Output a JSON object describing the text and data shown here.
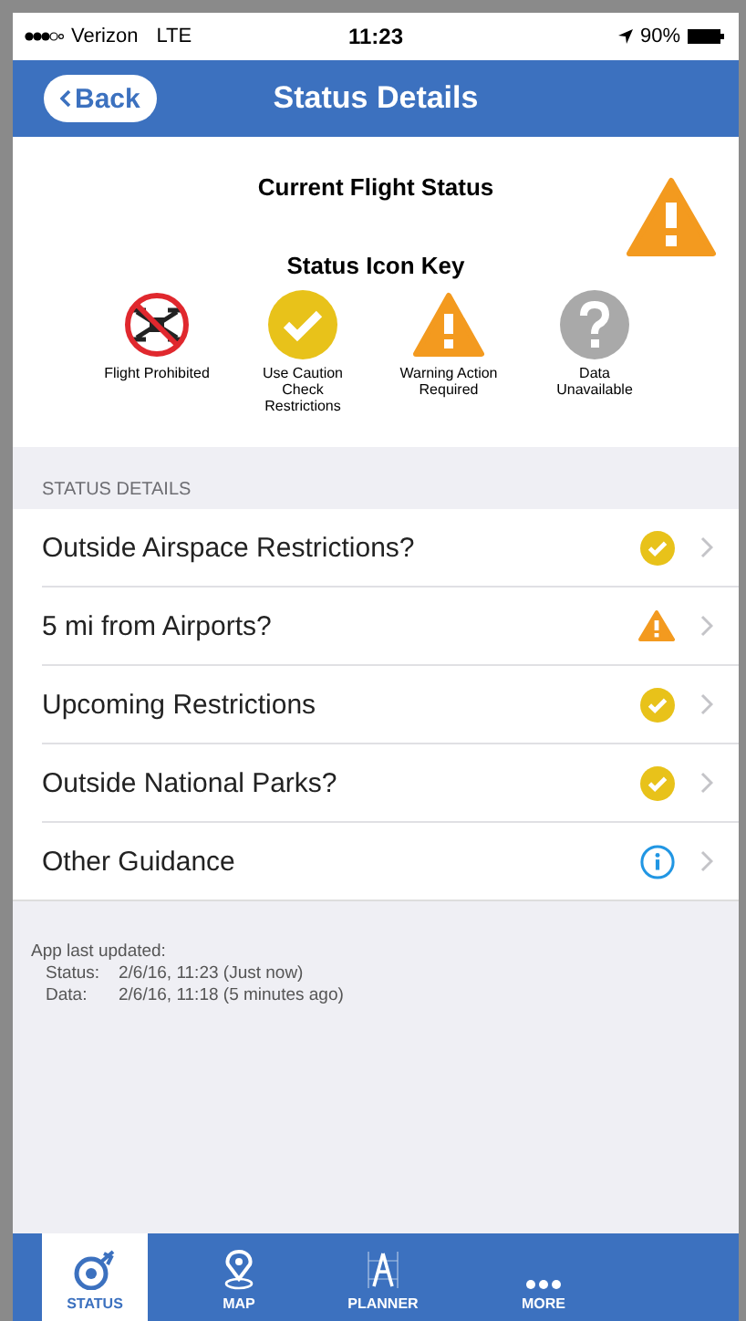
{
  "status_bar": {
    "carrier": "Verizon",
    "network": "LTE",
    "time": "11:23",
    "battery": "90%"
  },
  "nav": {
    "back": "Back",
    "title": "Status Details"
  },
  "current": {
    "title": "Current Flight Status",
    "kind": "warning"
  },
  "key": {
    "title": "Status Icon Key",
    "items": [
      {
        "kind": "prohibited",
        "label": "Flight Prohibited"
      },
      {
        "kind": "caution",
        "label": "Use Caution Check Restrictions"
      },
      {
        "kind": "warning",
        "label": "Warning Action Required"
      },
      {
        "kind": "unknown",
        "label": "Data Unavailable"
      }
    ]
  },
  "section": "STATUS DETAILS",
  "rows": [
    {
      "label": "Outside Airspace Restrictions?",
      "kind": "caution"
    },
    {
      "label": "5 mi from Airports?",
      "kind": "warning"
    },
    {
      "label": "Upcoming Restrictions",
      "kind": "caution"
    },
    {
      "label": "Outside National Parks?",
      "kind": "caution"
    },
    {
      "label": "Other Guidance",
      "kind": "info"
    }
  ],
  "updated": {
    "title": "App last updated:",
    "lines": [
      {
        "name": "Status:",
        "value": "2/6/16, 11:23 (Just now)"
      },
      {
        "name": "Data:",
        "value": "2/6/16, 11:18 (5 minutes ago)"
      }
    ]
  },
  "tabs": [
    {
      "label": "STATUS",
      "kind": "status",
      "selected": true
    },
    {
      "label": "MAP",
      "kind": "map",
      "selected": false
    },
    {
      "label": "PLANNER",
      "kind": "planner",
      "selected": false
    },
    {
      "label": "MORE",
      "kind": "more",
      "selected": false
    }
  ]
}
